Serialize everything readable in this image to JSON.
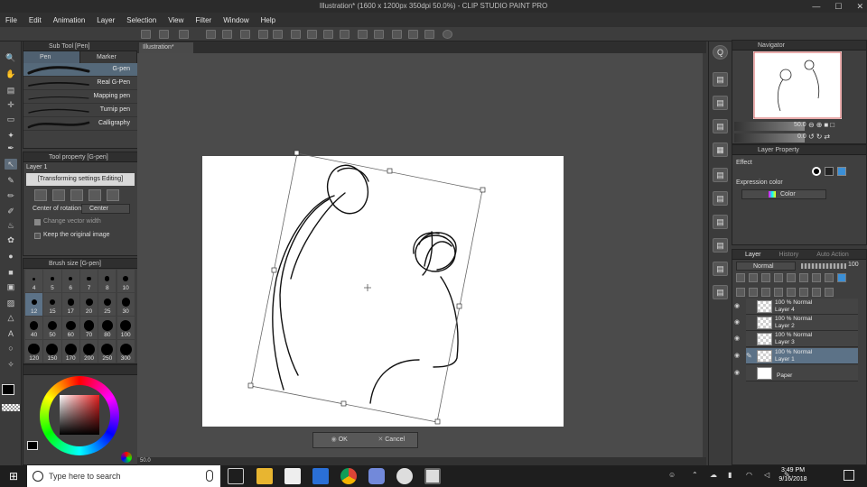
{
  "window": {
    "title": "Illustration* (1600 x 1200px 350dpi 50.0%) - CLIP STUDIO PAINT PRO",
    "controls": [
      "—",
      "☐",
      "✕"
    ]
  },
  "menu": [
    "File",
    "Edit",
    "Animation",
    "Layer",
    "Selection",
    "View",
    "Filter",
    "Window",
    "Help"
  ],
  "subtool": {
    "header": "Sub Tool [Pen]",
    "tabs": [
      "Pen",
      "Marker"
    ],
    "brushes": [
      "G-pen",
      "Real G-Pen",
      "Mapping pen",
      "Turnip pen",
      "Calligraphy"
    ]
  },
  "toolprop": {
    "header": "Tool property [G-pen]",
    "layer": "Layer 1",
    "banner": "[Transforming settings Editing]",
    "rotation_label": "Center of rotation",
    "rotation_value": "Center",
    "change_vector": "Change vector width",
    "keep_original": "Keep the original image"
  },
  "brushsize": {
    "header": "Brush size [G-pen]",
    "sizes": [
      "4",
      "5",
      "6",
      "7",
      "8",
      "10",
      "12",
      "15",
      "17",
      "20",
      "25",
      "30",
      "40",
      "50",
      "60",
      "70",
      "80",
      "100",
      "120",
      "150",
      "170",
      "200",
      "250",
      "300"
    ],
    "selected_index": 6
  },
  "document": {
    "tab": "Illustration*",
    "zoom_status": "50.0"
  },
  "transform": {
    "ok": "OK",
    "cancel": "Cancel"
  },
  "navigator": {
    "header": "Navigator",
    "zoom": "50.0",
    "rotation": "0.0"
  },
  "layerprop": {
    "header": "Layer Property",
    "effect": "Effect",
    "expression_label": "Expression color",
    "expression_value": "Color"
  },
  "layers": {
    "tabs": [
      "Layer",
      "History",
      "Auto Action"
    ],
    "blend_mode": "Normal",
    "opacity": "100",
    "rows": [
      {
        "mode": "100 % Normal",
        "name": "Layer 4"
      },
      {
        "mode": "100 % Normal",
        "name": "Layer 2"
      },
      {
        "mode": "100 % Normal",
        "name": "Layer 3"
      },
      {
        "mode": "100 % Normal",
        "name": "Layer 1"
      },
      {
        "mode": "",
        "name": "Paper"
      }
    ]
  },
  "taskbar": {
    "search_placeholder": "Type here to search",
    "time": "3:49 PM",
    "date": "9/16/2018"
  },
  "colors": {
    "accent_blue": "#5c7287",
    "canvas_bg": "#4b4b4b",
    "paper": "#ffffff"
  }
}
